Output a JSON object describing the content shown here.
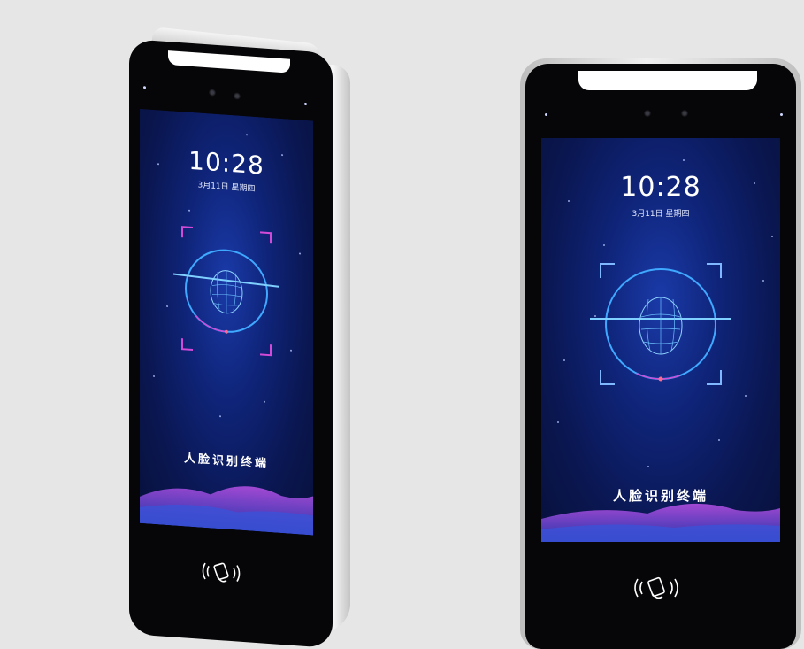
{
  "devices": [
    {
      "position": "left",
      "screen": {
        "time": "10:28",
        "date": "3月11日 星期四",
        "title": "人脸识别终端"
      },
      "icons": [
        "face-scan-icon",
        "nfc-card-icon"
      ]
    },
    {
      "position": "right",
      "screen": {
        "time": "10:28",
        "date": "3月11日 星期四",
        "title": "人脸识别终端"
      },
      "icons": [
        "face-scan-icon",
        "nfc-card-icon"
      ]
    }
  ],
  "colors": {
    "background": "#e6e6e6",
    "screen_blue": "#0f2478",
    "accent_cyan": "#3fa8ff",
    "accent_magenta": "#d24ad8",
    "device_frame": "#060608"
  }
}
